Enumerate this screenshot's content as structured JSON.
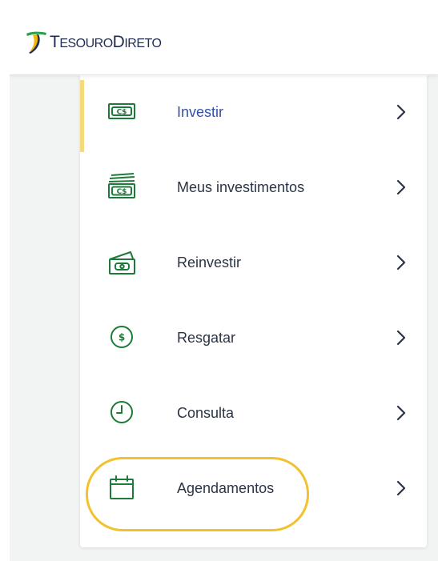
{
  "brand": {
    "name_cap1": "T",
    "name_rest1": "ESOURO",
    "name_cap2": "D",
    "name_rest2": "IRETO"
  },
  "colors": {
    "accent_active": "#f6d978",
    "active_label": "#3350a8",
    "icon_green": "#1e7a3a",
    "highlight_ring": "#f2c12e"
  },
  "menu": {
    "items": [
      {
        "label": "Investir",
        "icon": "cash-icon",
        "active": true
      },
      {
        "label": "Meus investimentos",
        "icon": "money-stack-icon",
        "active": false
      },
      {
        "label": "Reinvestir",
        "icon": "wallet-icon",
        "active": false
      },
      {
        "label": "Resgatar",
        "icon": "coin-icon",
        "active": false
      },
      {
        "label": "Consulta",
        "icon": "clock-icon",
        "active": false
      },
      {
        "label": "Agendamentos",
        "icon": "calendar-icon",
        "active": false
      }
    ]
  }
}
